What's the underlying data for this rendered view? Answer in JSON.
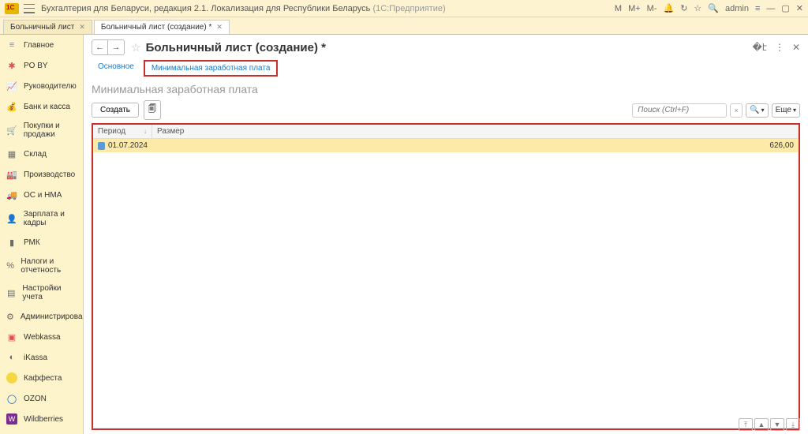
{
  "app": {
    "title": "Бухгалтерия для Беларуси, редакция 2.1. Локализация для Республики Беларусь",
    "subtitle": "(1С:Предприятие)",
    "user": "admin",
    "top_icons": {
      "m": "M",
      "m_plus": "M+",
      "m_minus": "M-"
    }
  },
  "tabs": {
    "items": [
      {
        "label": "Больничный лист"
      },
      {
        "label": "Больничный лист (создание) *"
      }
    ]
  },
  "sidebar": {
    "items": [
      {
        "icon": "≡",
        "label": "Главное",
        "color": "#888"
      },
      {
        "icon": "✱",
        "label": "PO BY",
        "color": "#d9534f"
      },
      {
        "icon": "📈",
        "label": "Руководителю",
        "color": "#e67e22"
      },
      {
        "icon": "💰",
        "label": "Банк и касса",
        "color": "#e6a700"
      },
      {
        "icon": "🛒",
        "label": "Покупки и продажи",
        "color": "#8e44ad"
      },
      {
        "icon": "▦",
        "label": "Склад",
        "color": "#6b6b6b"
      },
      {
        "icon": "🏭",
        "label": "Производство",
        "color": "#6b6b6b"
      },
      {
        "icon": "🚚",
        "label": "ОС и НМА",
        "color": "#6b6b6b"
      },
      {
        "icon": "👤",
        "label": "Зарплата и кадры",
        "color": "#6b6b6b"
      },
      {
        "icon": "▮",
        "label": "РМК",
        "color": "#6b6b6b"
      },
      {
        "icon": "%",
        "label": "Налоги и отчетность",
        "color": "#6b6b6b"
      },
      {
        "icon": "▤",
        "label": "Настройки учета",
        "color": "#6b6b6b"
      },
      {
        "icon": "⚙",
        "label": "Администрирование",
        "color": "#6b6b6b"
      },
      {
        "icon": "▣",
        "label": "Webkassa",
        "color": "#d9534f"
      },
      {
        "icon": "◐",
        "label": "iKassa",
        "color": "#6b6b6b"
      },
      {
        "icon": "",
        "label": "Каффеста",
        "color": ""
      },
      {
        "icon": "◯",
        "label": "OZON",
        "color": "#0066cc"
      },
      {
        "icon": "W",
        "label": "Wildberries",
        "color": "#7b2d8e"
      }
    ]
  },
  "page": {
    "title": "Больничный лист (создание) *",
    "sub_tabs": {
      "main": "Основное",
      "active": "Минимальная заработная плата"
    },
    "section_title": "Минимальная заработная плата",
    "create_btn": "Создать",
    "search_placeholder": "Поиск (Ctrl+F)",
    "more_btn": "Еще"
  },
  "grid": {
    "headers": {
      "period": "Период",
      "size": "Размер"
    },
    "rows": [
      {
        "period": "01.07.2024",
        "size": "626,00"
      }
    ]
  }
}
